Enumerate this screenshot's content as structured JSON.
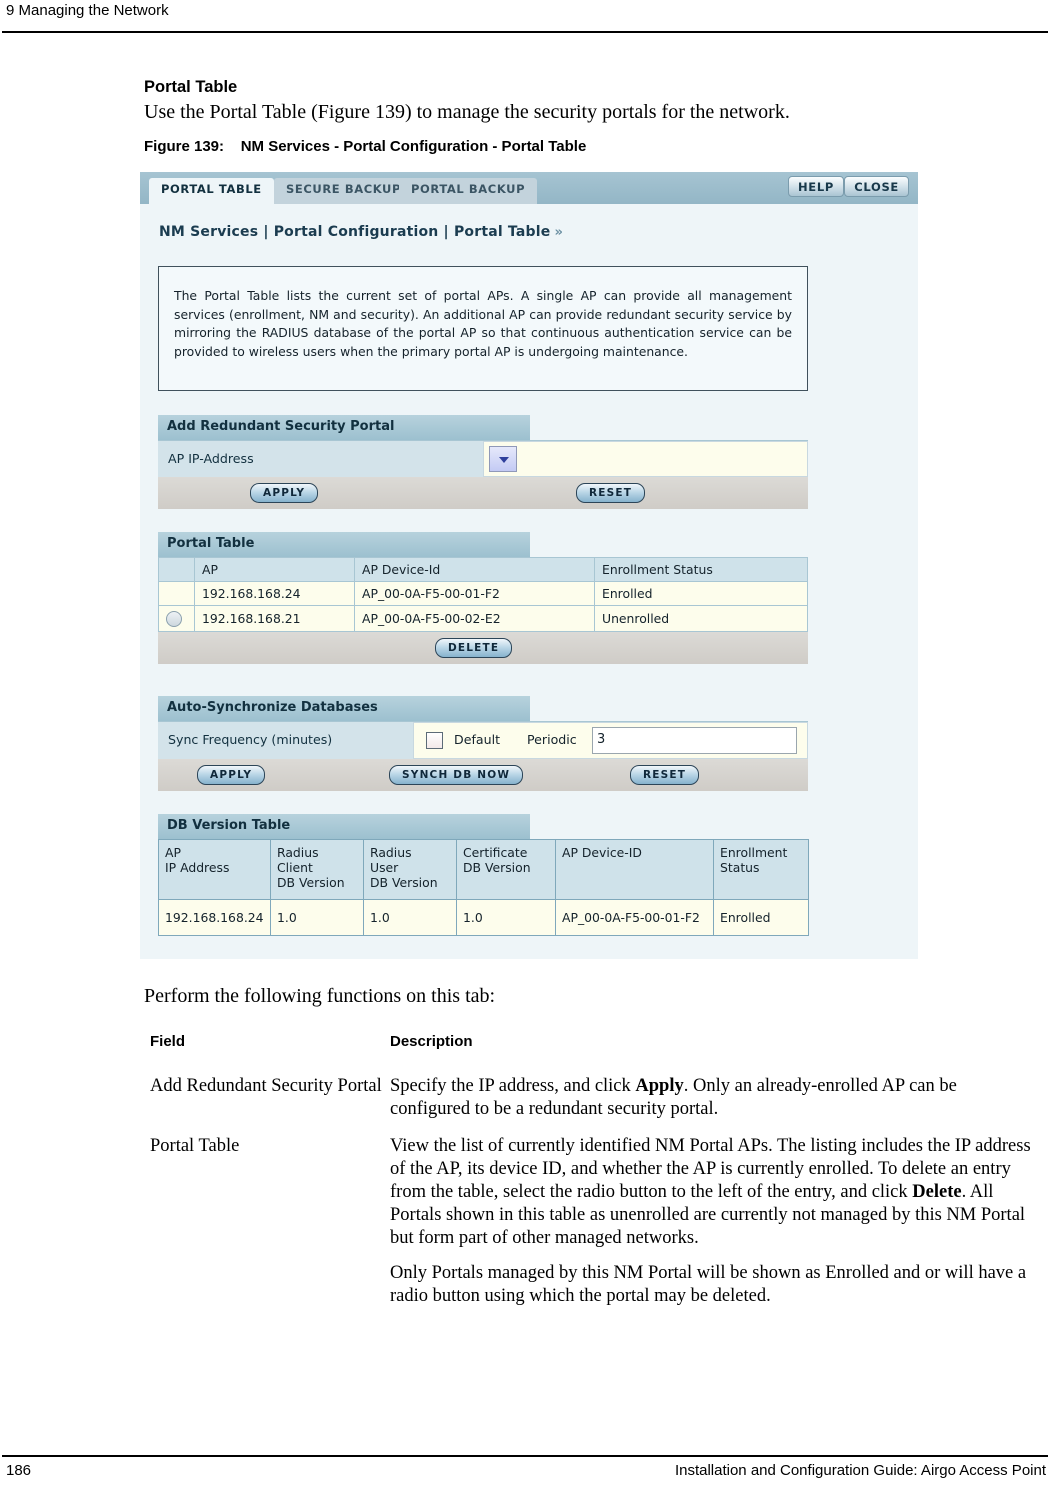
{
  "page": {
    "chapter_number": "9",
    "chapter_title": "Managing the Network",
    "running_head": "9  Managing the Network",
    "page_number": "186",
    "guide_title": "Installation and Configuration Guide: Airgo Access Point"
  },
  "content": {
    "section_title": "Portal Table",
    "intro_paragraph": "Use the Portal Table (Figure 139) to manage the security portals for the network.",
    "figure_caption": "Figure 139:    NM Services - Portal Configuration - Portal Table",
    "perform_paragraph": "Perform the following functions on this tab:"
  },
  "screenshot": {
    "tabs": [
      {
        "label": "PORTAL TABLE",
        "active": true
      },
      {
        "label": "SECURE BACKUP",
        "active": false
      },
      {
        "label": "PORTAL BACKUP",
        "active": false
      }
    ],
    "header_buttons": {
      "help": "HELP",
      "close": "CLOSE"
    },
    "breadcrumb": "NM Services | Portal Configuration | Portal Table",
    "breadcrumb_chevron": "»",
    "info_text": "The Portal Table lists the current set of portal APs. A single AP can provide all management services (enrollment, NM and security). An additional AP can provide redundant security service by mirroring the RADIUS database of the portal AP so that continuous authentication service can be provided to wireless users when the primary portal AP is undergoing maintenance.",
    "add_redundant_portal": {
      "title": "Add Redundant Security Portal",
      "field_label": "AP IP-Address",
      "select_value": "",
      "apply_label": "APPLY",
      "reset_label": "RESET"
    },
    "portal_table": {
      "title": "Portal Table",
      "columns": [
        "",
        "AP",
        "AP Device-Id",
        "Enrollment Status"
      ],
      "rows": [
        {
          "radio": false,
          "has_radio": false,
          "ap": "192.168.168.24",
          "device_id": "AP_00-0A-F5-00-01-F2",
          "status": "Enrolled"
        },
        {
          "radio": false,
          "has_radio": true,
          "ap": "192.168.168.21",
          "device_id": "AP_00-0A-F5-00-02-E2",
          "status": "Unenrolled"
        }
      ],
      "delete_label": "DELETE"
    },
    "auto_sync": {
      "title": "Auto-Synchronize Databases",
      "field_label": "Sync Frequency (minutes)",
      "default_checkbox_label": "Default",
      "default_checked": false,
      "periodic_label": "Periodic",
      "periodic_value": "3",
      "apply_label": "APPLY",
      "synch_label": "SYNCH DB NOW",
      "reset_label": "RESET"
    },
    "db_version_table": {
      "title": "DB Version Table",
      "columns": [
        "AP\nIP Address",
        "Radius\nClient\nDB Version",
        "Radius\nUser\nDB Version",
        "Certificate\nDB Version",
        "AP Device-ID",
        "Enrollment\nStatus"
      ],
      "rows": [
        {
          "ap_ip": "192.168.168.24",
          "radius_client_db": "1.0",
          "radius_user_db": "1.0",
          "certificate_db": "1.0",
          "device_id": "AP_00-0A-F5-00-01-F2",
          "status": "Enrolled"
        }
      ]
    }
  },
  "field_table": {
    "head_field": "Field",
    "head_description": "Description",
    "rows": [
      {
        "field": "Add Redundant Security Portal",
        "desc_parts": [
          [
            {
              "t": "Specify the IP address, and click "
            },
            {
              "t": "Apply",
              "b": true
            },
            {
              "t": ". Only an already-enrolled AP can be configured to be a redundant security portal."
            }
          ]
        ]
      },
      {
        "field": "Portal Table",
        "desc_parts": [
          [
            {
              "t": "View the list of currently identified NM Portal APs. The listing includes the IP address of the AP, its device ID, and whether the AP is currently enrolled. To delete an entry from the table, select the radio button to the left of the entry, and click "
            },
            {
              "t": "Delete",
              "b": true
            },
            {
              "t": ". All Portals shown in this table as unenrolled are currently not managed by this NM Portal but form part of other managed networks."
            }
          ],
          [
            {
              "t": "Only Portals managed by this NM Portal will be shown as Enrolled and or will have a radio button using which the portal may be deleted."
            }
          ]
        ]
      }
    ]
  },
  "colors": {
    "tabbar": "#a6c4d2",
    "panel_header": "#9cc0cf",
    "panel_body": "#d3e3ea",
    "panel_footer": "#d5d2cd",
    "cell_bg": "#fdfdec",
    "shot_bg": "#eef5f8",
    "text_dark": "#12303f"
  }
}
